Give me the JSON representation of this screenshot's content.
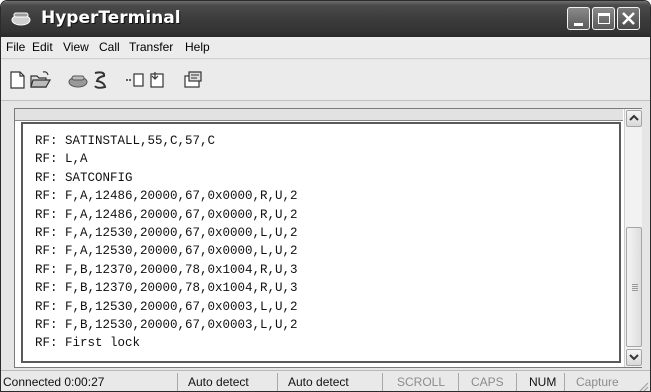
{
  "window": {
    "title": "HyperTerminal"
  },
  "menu": [
    "File",
    "Edit",
    "View",
    "Call",
    "Transfer",
    "Help"
  ],
  "toolbar": {
    "icons": [
      "new-document-icon",
      "open-folder-icon",
      "phone-connect-icon",
      "phone-disconnect-icon",
      "send-icon",
      "receive-icon",
      "properties-icon"
    ]
  },
  "terminal": {
    "lines": [
      "RF: SATINSTALL,55,C,57,C",
      "RF: L,A",
      "RF: SATCONFIG",
      "RF: F,A,12486,20000,67,0x0000,R,U,2",
      "RF: F,A,12486,20000,67,0x0000,R,U,2",
      "RF: F,A,12530,20000,67,0x0000,L,U,2",
      "RF: F,A,12530,20000,67,0x0000,L,U,2",
      "RF: F,B,12370,20000,78,0x1004,R,U,3",
      "RF: F,B,12370,20000,78,0x1004,R,U,3",
      "RF: F,B,12530,20000,67,0x0003,L,U,2",
      "RF: F,B,12530,20000,67,0x0003,L,U,2",
      "RF: First lock"
    ]
  },
  "status": {
    "connection": "Connected 0:00:27",
    "detect1": "Auto detect",
    "detect2": "Auto detect",
    "scroll": "SCROLL",
    "caps": "CAPS",
    "num": "NUM",
    "capture": "Capture"
  }
}
